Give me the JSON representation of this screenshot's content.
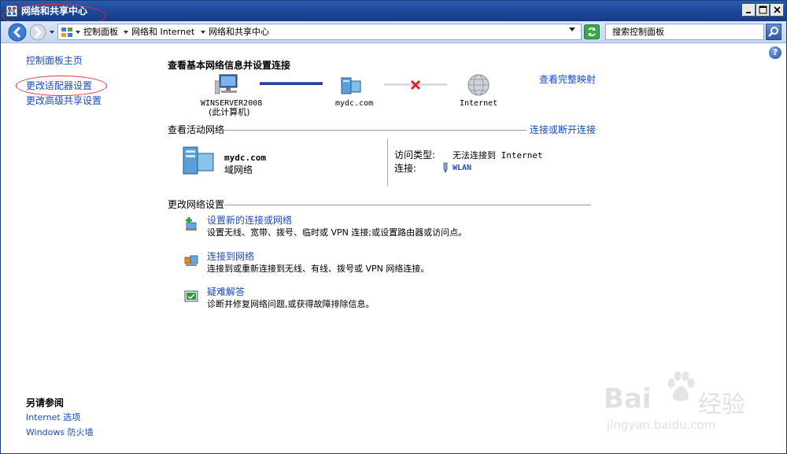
{
  "window": {
    "title": "网络和共享中心"
  },
  "address": {
    "crumbs": [
      "控制面板",
      "网络和 Internet",
      "网络和共享中心"
    ],
    "search_placeholder": "搜索控制面板"
  },
  "left_pane": {
    "home_link": "控制面板主页",
    "links": [
      "更改适配器设置",
      "更改高级共享设置"
    ],
    "see_also_title": "另请参阅",
    "see_also": [
      "Internet 选项",
      "Windows 防火墙"
    ]
  },
  "main": {
    "title": "查看基本网络信息并设置连接",
    "full_map_link": "查看完整映射",
    "map_nodes": [
      {
        "name": "WINSERVER2008",
        "sub": "(此计算机)"
      },
      {
        "name": "mydc.com",
        "sub": ""
      },
      {
        "name": "Internet",
        "sub": ""
      }
    ],
    "active_networks": {
      "heading": "查看活动网络",
      "action_link": "连接或断开连接",
      "network_name": "mydc.com",
      "network_type": "域网络",
      "access_type_label": "访问类型:",
      "access_type_value": "无法连接到 Internet",
      "connection_label": "连接:",
      "connection_value": "WLAN"
    },
    "change_settings": {
      "heading": "更改网络设置",
      "tasks": [
        {
          "title": "设置新的连接或网络",
          "desc": "设置无线、宽带、拨号、临时或 VPN 连接;或设置路由器或访问点。"
        },
        {
          "title": "连接到网络",
          "desc": "连接到或重新连接到无线、有线、拨号或 VPN 网络连接。"
        },
        {
          "title": "疑难解答",
          "desc": "诊断并修复网络问题,或获得故障排除信息。"
        }
      ]
    }
  },
  "watermark": {
    "brand": "Bai",
    "brand2": "经验",
    "url": "jingyan.baidu.com"
  },
  "colors": {
    "link": "#1a4bbf",
    "titlebar": "#1e4a9c",
    "annotation": "#e0303a"
  }
}
